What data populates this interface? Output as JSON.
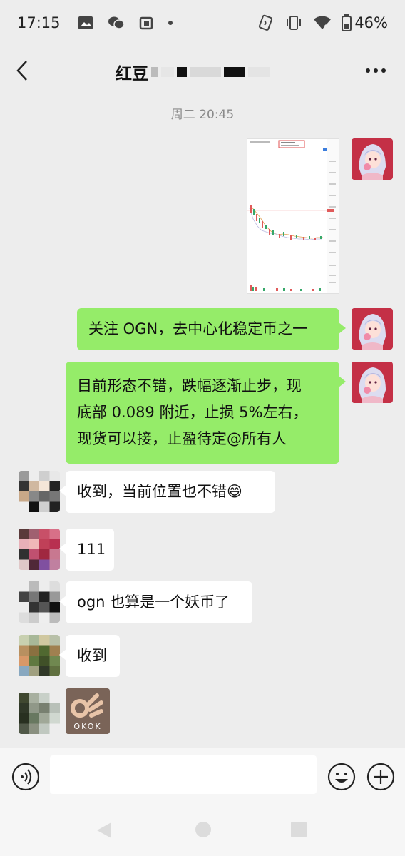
{
  "status_bar": {
    "time": "17:15",
    "battery": "46%",
    "icons": [
      "image-icon",
      "wechat-icon",
      "app-icon",
      "dot-icon",
      "nfc-icon",
      "vibrate-icon",
      "wifi-icon",
      "battery-icon"
    ]
  },
  "header": {
    "title": "红豆",
    "back_icon": "chevron-left-icon",
    "more_icon": "more-icon"
  },
  "chat": {
    "timestamp": "周二 20:45",
    "messages": [
      {
        "side": "right",
        "type": "image",
        "content": "chart-screenshot"
      },
      {
        "side": "right",
        "type": "text",
        "text": "关注 OGN，去中心化稳定币之一"
      },
      {
        "side": "right",
        "type": "text",
        "lines": [
          "目前形态不错，跌幅逐渐止步，现",
          "底部 0.089 附近，止损 5%左右，",
          "现货可以接，止盈待定@所有人"
        ]
      },
      {
        "side": "left",
        "type": "text",
        "text": "收到，当前位置也不错😄"
      },
      {
        "side": "left",
        "type": "text",
        "text": "111"
      },
      {
        "side": "left",
        "type": "text",
        "text": "ogn 也算是一个妖币了"
      },
      {
        "side": "left",
        "type": "text",
        "text": "收到"
      },
      {
        "side": "left",
        "type": "sticker",
        "label": "OKOK"
      }
    ]
  },
  "colors": {
    "bg": "#ededed",
    "bubble_green": "#95ec69",
    "bubble_white": "#ffffff"
  },
  "input_bar": {
    "voice_icon": "voice-icon",
    "emoji_icon": "emoji-icon",
    "plus_icon": "plus-icon"
  },
  "nav_bar": {
    "icons": [
      "nav-back-icon",
      "nav-home-icon",
      "nav-recent-icon"
    ]
  }
}
